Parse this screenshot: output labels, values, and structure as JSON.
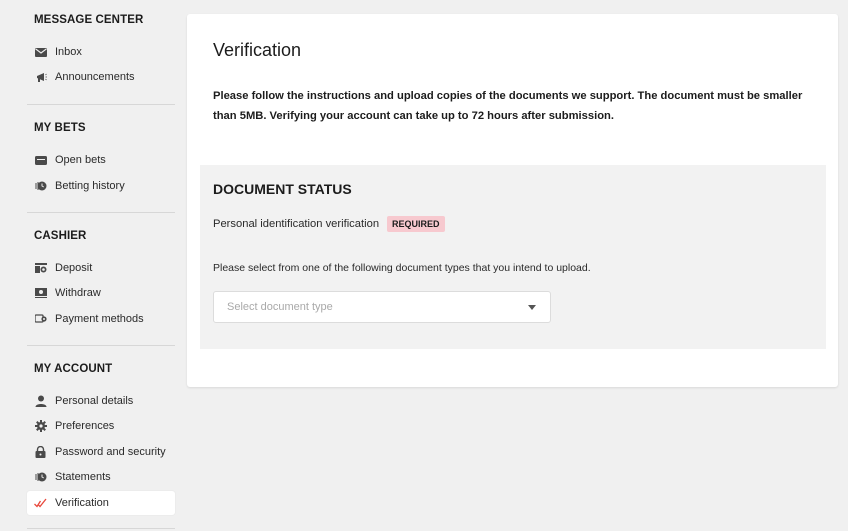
{
  "sidebar": {
    "sections": [
      {
        "title": "MESSAGE CENTER",
        "items": [
          {
            "label": "Inbox",
            "icon": "envelope-icon"
          },
          {
            "label": "Announcements",
            "icon": "megaphone-icon"
          }
        ]
      },
      {
        "title": "MY BETS",
        "items": [
          {
            "label": "Open bets",
            "icon": "ticket-icon"
          },
          {
            "label": "Betting history",
            "icon": "history-icon"
          }
        ]
      },
      {
        "title": "CASHIER",
        "items": [
          {
            "label": "Deposit",
            "icon": "deposit-icon"
          },
          {
            "label": "Withdraw",
            "icon": "withdraw-icon"
          },
          {
            "label": "Payment methods",
            "icon": "payment-methods-icon"
          }
        ]
      },
      {
        "title": "MY ACCOUNT",
        "items": [
          {
            "label": "Personal details",
            "icon": "person-icon"
          },
          {
            "label": "Preferences",
            "icon": "gear-icon"
          },
          {
            "label": "Password and security",
            "icon": "lock-icon"
          },
          {
            "label": "Statements",
            "icon": "statements-icon"
          },
          {
            "label": "Verification",
            "icon": "checkmark-icon",
            "active": true
          }
        ]
      }
    ]
  },
  "main": {
    "title": "Verification",
    "intro": "Please follow the instructions and upload copies of the documents we support. The document must be smaller than 5MB. Verifying your account can take up to 72 hours after submission.",
    "status": {
      "title": "DOCUMENT STATUS",
      "item_label": "Personal identification verification",
      "badge": "REQUIRED",
      "hint": "Please select from one of the following document types that you intend to upload.",
      "select_placeholder": "Select document type"
    }
  },
  "colors": {
    "background": "#f0f0f0",
    "card": "#ffffff",
    "status_box": "#f2f2f2",
    "badge_bg": "#f7c9cf",
    "accent_check": "#e8483c"
  }
}
